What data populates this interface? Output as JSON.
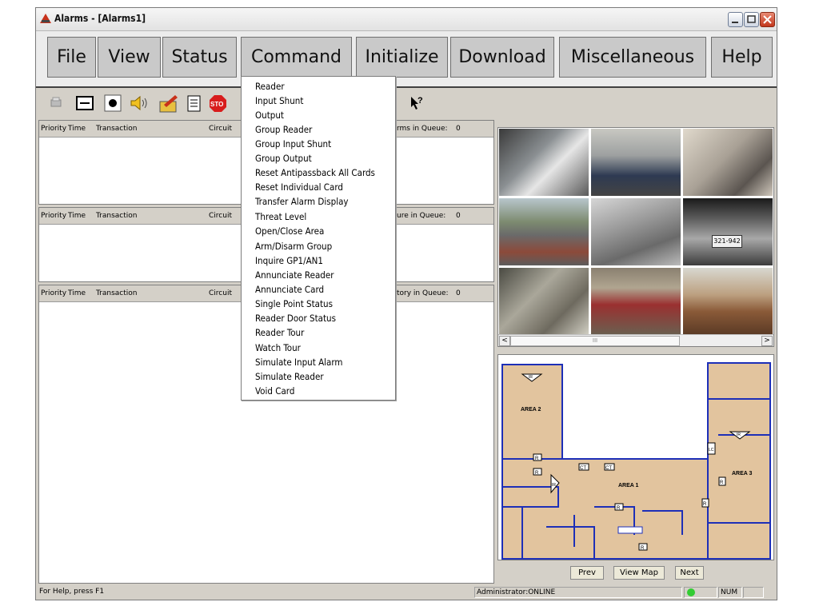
{
  "window": {
    "title": "Alarms - [Alarms1]",
    "accent": "#c8311a"
  },
  "menu": [
    "File",
    "View",
    "Status",
    "Command",
    "Initialize",
    "Download",
    "Miscellaneous",
    "Help"
  ],
  "toolbar": {
    "icons": [
      "print-icon",
      "minus-box-icon",
      "record-icon",
      "speaker-icon",
      "edit-icon",
      "notes-icon",
      "stop-icon",
      "help-pointer-icon"
    ],
    "stop_label": "STO",
    "help_label": "?"
  },
  "panes": [
    {
      "headers": [
        "Priority",
        "Time",
        "Transaction",
        "Circuit"
      ],
      "queue_label": "rms in Queue:",
      "queue_count": "0"
    },
    {
      "headers": [
        "Priority",
        "Time",
        "Transaction",
        "Circuit"
      ],
      "queue_label": "ure in Queue:",
      "queue_count": "0"
    },
    {
      "headers": [
        "Priority",
        "Time",
        "Transaction",
        "Circuit"
      ],
      "queue_label": "tory in Queue:",
      "queue_count": "0"
    }
  ],
  "command_menu": [
    "Reader",
    "Input Shunt",
    "Output",
    "Group Reader",
    "Group Input Shunt",
    "Group Output",
    "Reset Antipassback All Cards",
    "Reset Individual Card",
    "Transfer Alarm Display",
    "Threat Level",
    "Open/Close Area",
    "Arm/Disarm Group",
    "Inquire GP1/AN1",
    "Annunciate Reader",
    "Annunciate Card",
    "Single Point Status",
    "Reader Door Status",
    "Reader Tour",
    "Watch Tour",
    "Simulate Input Alarm",
    "Simulate Reader",
    "Void Card"
  ],
  "camera_scroll": {
    "left": "<",
    "right": ">",
    "thumb": "III"
  },
  "map": {
    "areas": [
      "AREA 2",
      "AREA 1",
      "AREA 3"
    ],
    "markers": {
      "ir": "IR",
      "r": "R",
      "ct": "CT",
      "lc": "LC"
    },
    "plate": "321-942"
  },
  "map_buttons": {
    "prev": "Prev",
    "view_map": "View Map",
    "next": "Next"
  },
  "status": {
    "help": "For Help, press F1",
    "user": "Administrator:ONLINE",
    "num": "NUM",
    "indicator_color": "#33cc33"
  }
}
